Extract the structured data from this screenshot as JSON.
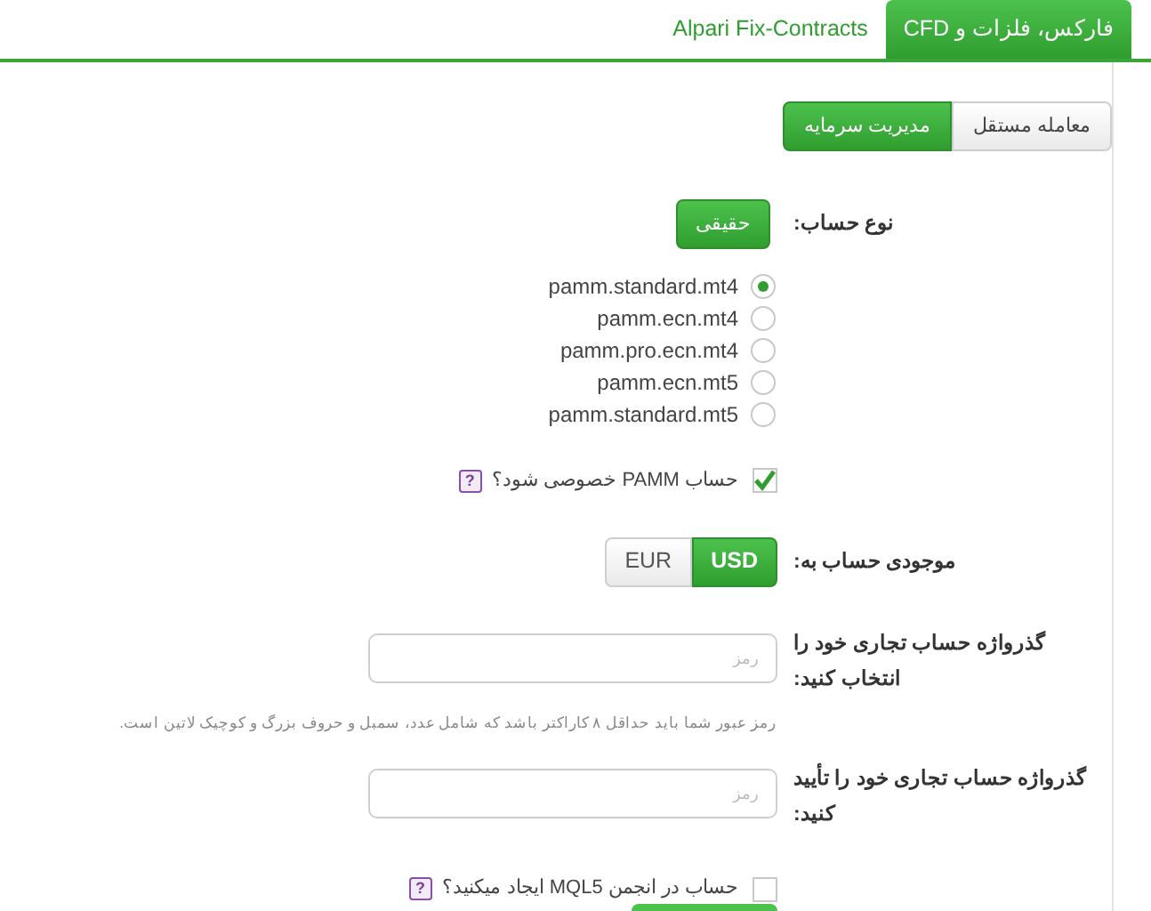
{
  "tabs": [
    {
      "label": "فارکس، فلزات و CFD",
      "selected": true
    },
    {
      "label": "Alpari Fix-Contracts",
      "selected": false
    }
  ],
  "mode_switch": [
    {
      "label": "معامله مستقل",
      "selected": false
    },
    {
      "label": "مدیریت سرمایه",
      "selected": true
    }
  ],
  "account_type": {
    "label": "نوع حساب:",
    "button": "حقیقی"
  },
  "servers": [
    {
      "label": "pamm.standard.mt4",
      "selected": true
    },
    {
      "label": "pamm.ecn.mt4",
      "selected": false
    },
    {
      "label": "pamm.pro.ecn.mt4",
      "selected": false
    },
    {
      "label": "pamm.ecn.mt5",
      "selected": false
    },
    {
      "label": "pamm.standard.mt5",
      "selected": false
    }
  ],
  "private_pamm": {
    "label": "حساب PAMM خصوصی شود؟",
    "checked": true,
    "help": "?"
  },
  "currency": {
    "label": "موجودی حساب به:",
    "options": [
      {
        "label": "USD",
        "selected": true
      },
      {
        "label": "EUR",
        "selected": false
      }
    ]
  },
  "password": {
    "label": "گذرواژه حساب تجاری خود را انتخاب کنید:",
    "placeholder": "رمز",
    "hint": "رمز عبور شما باید حداقل ۸ کاراکتر باشد که شامل عدد، سمبل و حروف بزرگ و کوچیک لاتین است."
  },
  "confirm_password": {
    "label": "گذرواژه حساب تجاری خود را تأیید کنید:",
    "placeholder": "رمز"
  },
  "mql5_account": {
    "label": "حساب در انجمن MQL5 ایجاد میکنید؟",
    "checked": false,
    "help": "?"
  }
}
